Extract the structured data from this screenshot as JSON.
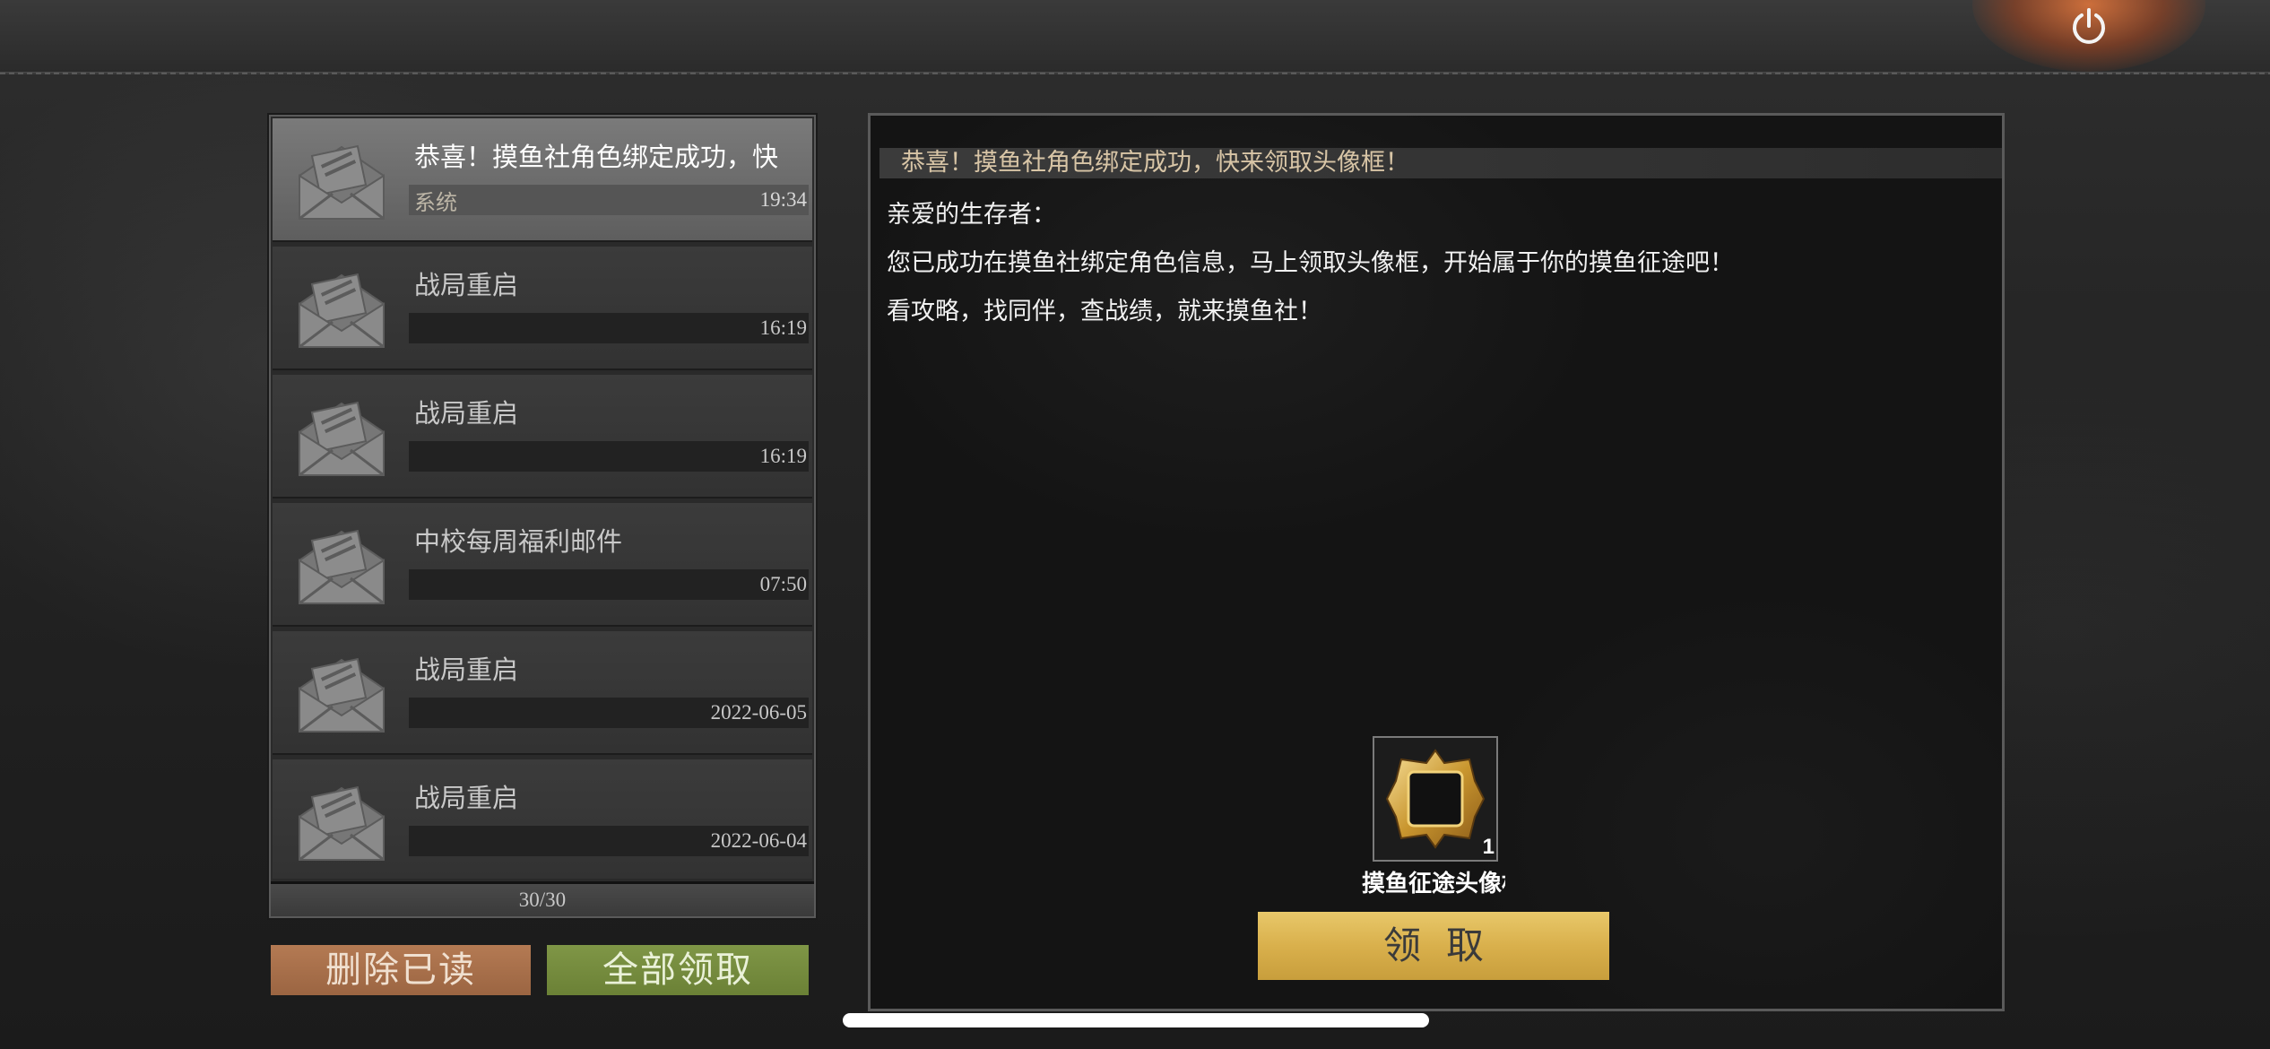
{
  "mails": [
    {
      "title": "恭喜！摸鱼社角色绑定成功，快",
      "sender": "系统",
      "time": "19:34",
      "selected": true
    },
    {
      "title": "战局重启",
      "sender": "",
      "time": "16:19",
      "selected": false
    },
    {
      "title": "战局重启",
      "sender": "",
      "time": "16:19",
      "selected": false
    },
    {
      "title": "中校每周福利邮件",
      "sender": "",
      "time": "07:50",
      "selected": false
    },
    {
      "title": "战局重启",
      "sender": "",
      "time": "2022-06-05",
      "selected": false
    },
    {
      "title": "战局重启",
      "sender": "",
      "time": "2022-06-04",
      "selected": false
    }
  ],
  "mail_count": "30/30",
  "buttons": {
    "delete_read": "删除已读",
    "claim_all": "全部领取"
  },
  "detail": {
    "title": "恭喜！摸鱼社角色绑定成功，快来领取头像框！",
    "greeting": "亲爱的生存者：",
    "line1": "您已成功在摸鱼社绑定角色信息，马上领取头像框，开始属于你的摸鱼征途吧！",
    "line2": "看攻略，找同伴，查战绩，就来摸鱼社！",
    "reward": {
      "name": "摸鱼征途头像框",
      "quantity": "1",
      "icon": "gold-avatar-frame-icon"
    },
    "claim_label": "领取"
  },
  "icons": {
    "power": "power-icon",
    "mail": "open-envelope-icon"
  },
  "colors": {
    "delete_button": "#b47a53",
    "claim_all_button": "#7f9646",
    "claim_button": "#e8c86a",
    "power_glow": "#e67a3c"
  }
}
